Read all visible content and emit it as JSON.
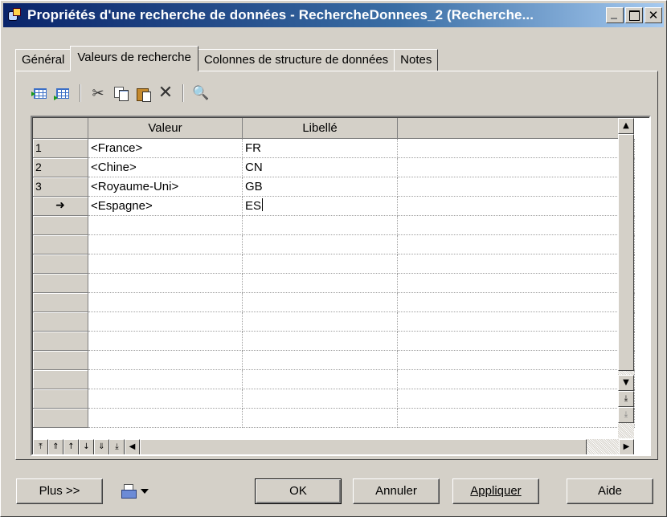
{
  "window": {
    "title": "Propriétés d'une recherche de données - RechercheDonnees_2 (Recherche...",
    "controls": {
      "minimize": "_",
      "maximize": "□",
      "close": "✕"
    }
  },
  "tabs": [
    {
      "label": "Général",
      "active": false
    },
    {
      "label": "Valeurs de recherche",
      "active": true
    },
    {
      "label": "Colonnes de structure de données",
      "active": false
    },
    {
      "label": "Notes",
      "active": false
    }
  ],
  "toolbar": {
    "icons": [
      "insert-row-icon",
      "add-row-icon",
      "cut-icon",
      "copy-icon",
      "paste-icon",
      "delete-icon",
      "find-icon"
    ]
  },
  "grid": {
    "columns": [
      "Valeur",
      "Libellé"
    ],
    "rows": [
      {
        "header": "1",
        "valeur": "<France>",
        "libelle": "FR"
      },
      {
        "header": "2",
        "valeur": "<Chine>",
        "libelle": "CN"
      },
      {
        "header": "3",
        "valeur": "<Royaume-Uni>",
        "libelle": "GB"
      },
      {
        "header": "➜",
        "valeur": "<Espagne>",
        "libelle": "ES"
      }
    ],
    "empty_rows": 11,
    "current_row_indicator": "➜"
  },
  "buttons": {
    "more": "Plus >>",
    "ok": "OK",
    "cancel": "Annuler",
    "apply": "Appliquer",
    "help": "Aide"
  },
  "colors": {
    "title_bar_start": "#0a246a",
    "title_bar_end": "#a6caf0",
    "face": "#d4d0c8"
  }
}
